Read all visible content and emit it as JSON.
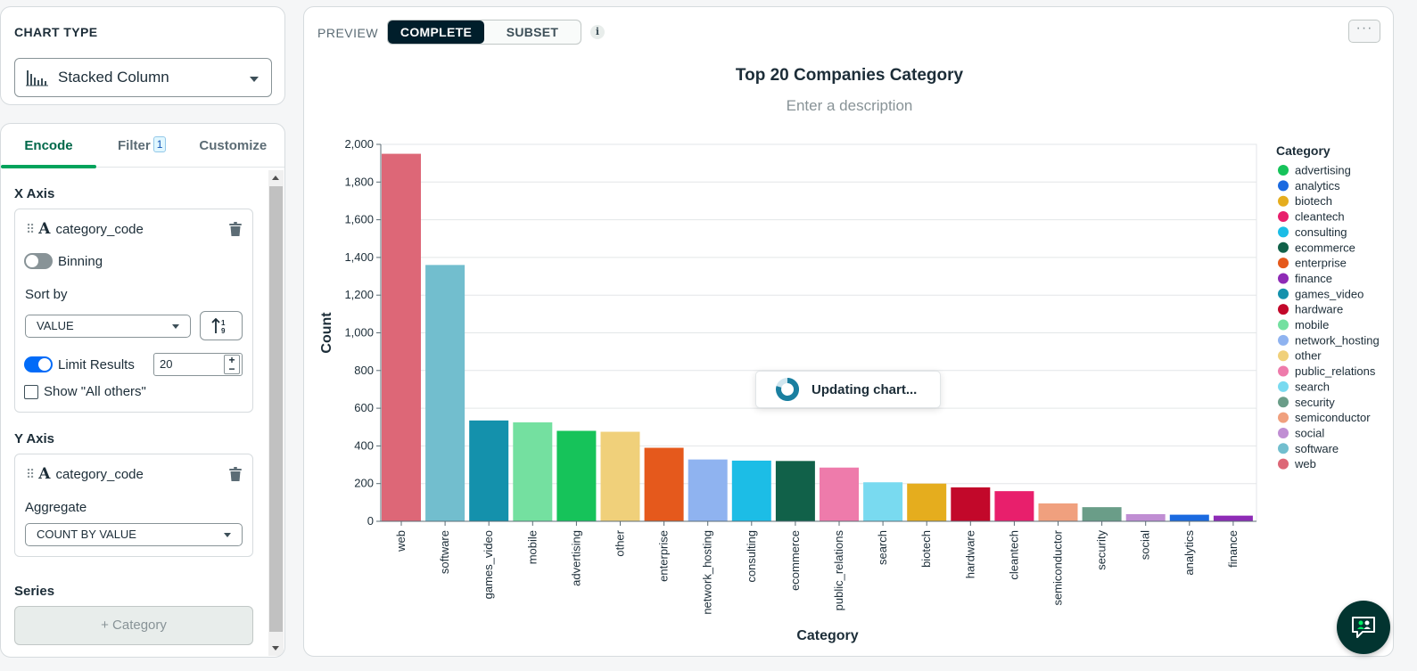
{
  "chart_type_panel": {
    "title": "CHART TYPE",
    "selected": "Stacked Column"
  },
  "tabs": {
    "encode": "Encode",
    "filter": "Filter",
    "filter_count": "1",
    "customize": "Customize"
  },
  "x_axis": {
    "heading": "X Axis",
    "field": "category_code",
    "binning_label": "Binning",
    "binning_on": false,
    "sort_by_label": "Sort by",
    "sort_value": "VALUE",
    "limit_label": "Limit Results",
    "limit_on": true,
    "limit_value": "20",
    "show_others_label": "Show \"All others\""
  },
  "y_axis": {
    "heading": "Y Axis",
    "field": "category_code",
    "aggregate_label": "Aggregate",
    "aggregate_value": "COUNT BY VALUE"
  },
  "series": {
    "heading": "Series",
    "add_label": "+ Category"
  },
  "preview": {
    "label": "PREVIEW",
    "complete": "COMPLETE",
    "subset": "SUBSET",
    "info": "i",
    "more": "···"
  },
  "toast": {
    "text": "Updating chart..."
  },
  "chart_data": {
    "type": "bar",
    "title": "Top 20 Companies Category",
    "description_placeholder": "Enter a description",
    "xlabel": "Category",
    "ylabel": "Count",
    "ylim": [
      0,
      2000
    ],
    "yticks": [
      0,
      200,
      400,
      600,
      800,
      1000,
      1200,
      1400,
      1600,
      1800,
      2000
    ],
    "ytick_labels": [
      "0",
      "200",
      "400",
      "600",
      "800",
      "1,000",
      "1,200",
      "1,400",
      "1,600",
      "1,800",
      "2,000"
    ],
    "grid": true,
    "legend_title": "Category",
    "legend_position": "right",
    "categories": [
      "web",
      "software",
      "games_video",
      "mobile",
      "advertising",
      "other",
      "enterprise",
      "network_hosting",
      "consulting",
      "ecommerce",
      "public_relations",
      "search",
      "biotech",
      "hardware",
      "cleantech",
      "semiconductor",
      "security",
      "social",
      "analytics",
      "finance"
    ],
    "values": [
      1950,
      1360,
      535,
      525,
      480,
      475,
      390,
      328,
      322,
      320,
      285,
      207,
      200,
      180,
      160,
      95,
      75,
      38,
      35,
      30
    ],
    "legend": [
      {
        "name": "advertising",
        "color": "#16c35a"
      },
      {
        "name": "analytics",
        "color": "#1b6ae0"
      },
      {
        "name": "biotech",
        "color": "#e5ad1e"
      },
      {
        "name": "cleantech",
        "color": "#e81f6c"
      },
      {
        "name": "consulting",
        "color": "#1cbde6"
      },
      {
        "name": "ecommerce",
        "color": "#116149"
      },
      {
        "name": "enterprise",
        "color": "#e5591c"
      },
      {
        "name": "finance",
        "color": "#8e2bb6"
      },
      {
        "name": "games_video",
        "color": "#1491ac"
      },
      {
        "name": "hardware",
        "color": "#c2082a"
      },
      {
        "name": "mobile",
        "color": "#74e0a0"
      },
      {
        "name": "network_hosting",
        "color": "#8fb3f0"
      },
      {
        "name": "other",
        "color": "#f0d07a"
      },
      {
        "name": "public_relations",
        "color": "#ee7bab"
      },
      {
        "name": "search",
        "color": "#79daf0"
      },
      {
        "name": "security",
        "color": "#6a9d88"
      },
      {
        "name": "semiconductor",
        "color": "#f0a07e"
      },
      {
        "name": "social",
        "color": "#c08ed3"
      },
      {
        "name": "software",
        "color": "#72bece"
      },
      {
        "name": "web",
        "color": "#dd6777"
      }
    ]
  }
}
